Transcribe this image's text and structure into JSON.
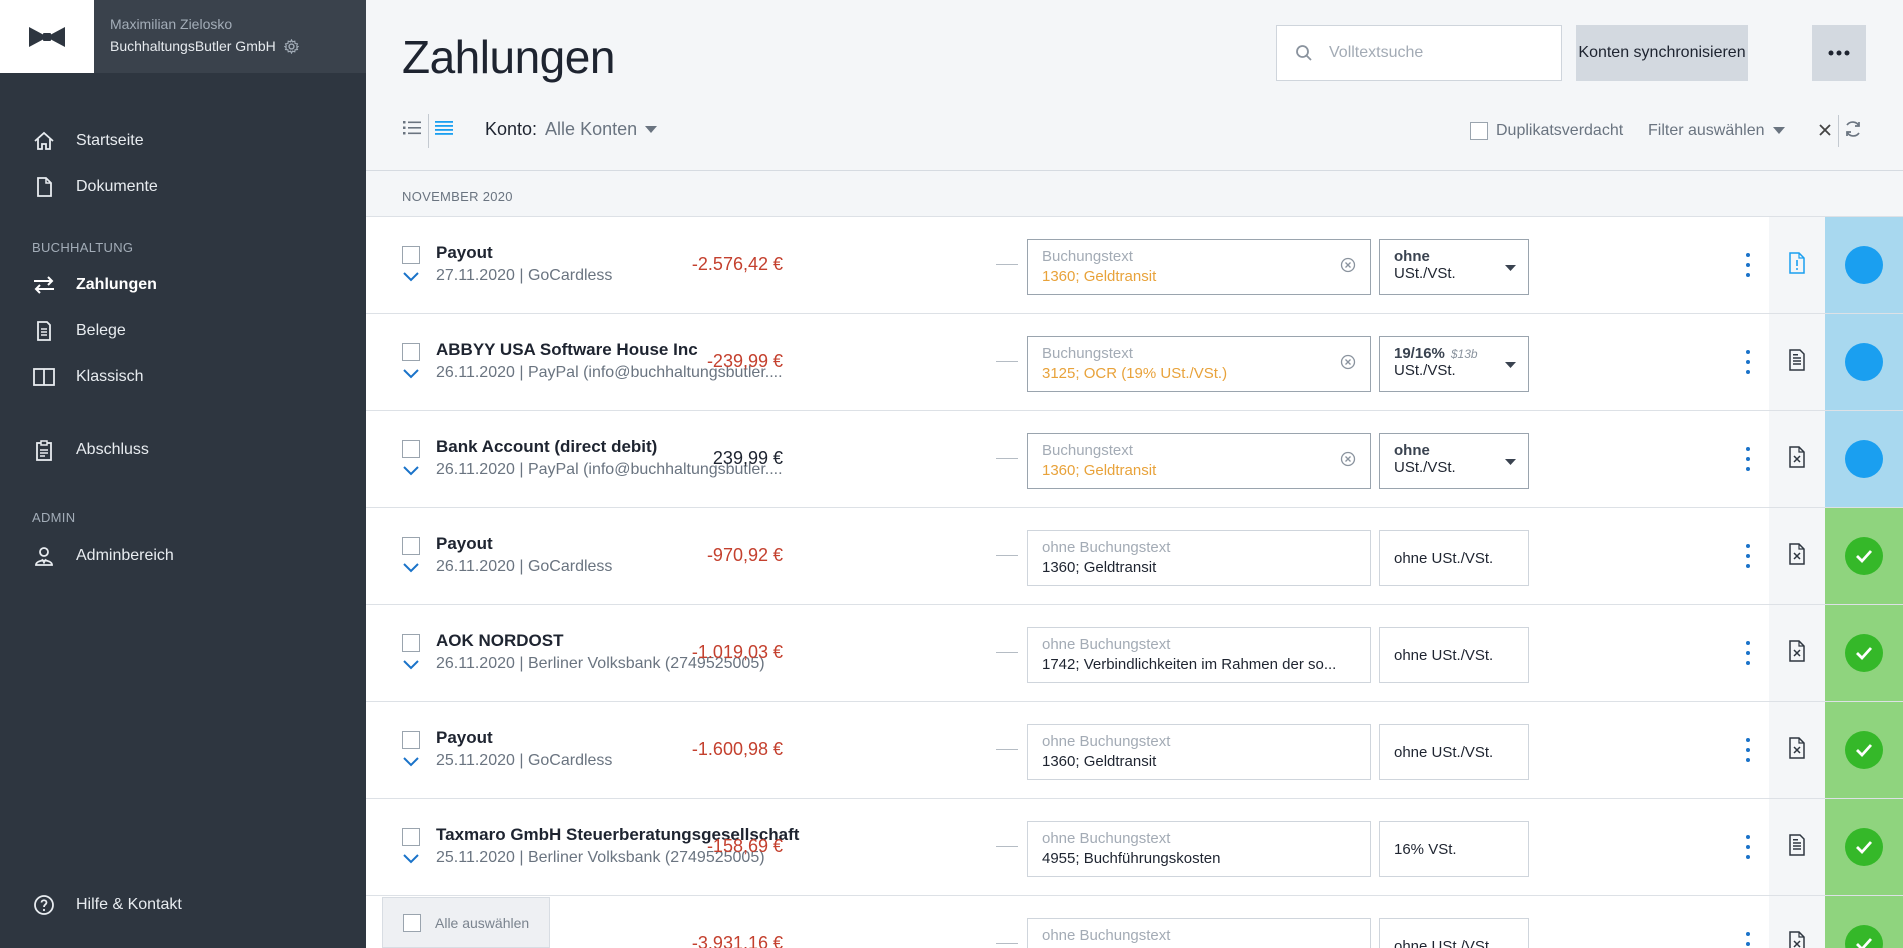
{
  "sidebar": {
    "user_name": "Maximilian Zielosko",
    "company_name": "BuchhaltungsButler GmbH",
    "items_top": [
      {
        "label": "Startseite",
        "icon": "home-icon"
      },
      {
        "label": "Dokumente",
        "icon": "document-icon"
      }
    ],
    "section_buchhaltung": "BUCHHALTUNG",
    "items_buchhaltung": [
      {
        "label": "Zahlungen",
        "icon": "transfer-arrows-icon",
        "active": true
      },
      {
        "label": "Belege",
        "icon": "receipt-icon"
      },
      {
        "label": "Klassisch",
        "icon": "book-icon"
      }
    ],
    "abschluss": "Abschluss",
    "section_admin": "ADMIN",
    "admin_item": "Adminbereich",
    "help": "Hilfe & Kontakt"
  },
  "header": {
    "title": "Zahlungen",
    "search_placeholder": "Volltextsuche",
    "sync_label": "Konten synchronisieren"
  },
  "toolbar": {
    "konto_label": "Konto:",
    "konto_value": "Alle Konten",
    "duplicate_label": "Duplikatsverdacht",
    "filter_label": "Filter auswählen"
  },
  "month_label": "NOVEMBER 2020",
  "payments": [
    {
      "name": "Payout",
      "meta": "27.11.2020 | GoCardless",
      "amount": "-2.576,42 €",
      "negative": true,
      "booking_label": "Buchungstext",
      "account": "1360; Geldtransit",
      "pending": true,
      "tax_line1": "ohne",
      "tax_line2": "USt./VSt.",
      "tax_hint": "",
      "doc": "file-alert-icon",
      "status": "open"
    },
    {
      "name": "ABBYY USA Software House Inc",
      "meta": "26.11.2020 | PayPal (info@buchhaltungsbutler....",
      "amount": "-239,99 €",
      "negative": true,
      "booking_label": "Buchungstext",
      "account": "3125; OCR (19% USt./VSt.)",
      "pending": true,
      "tax_line1": "19/16%",
      "tax_line2": "USt./VSt.",
      "tax_hint": "$13b",
      "doc": "receipt-icon",
      "status": "open"
    },
    {
      "name": "Bank Account (direct debit)",
      "meta": "26.11.2020 | PayPal (info@buchhaltungsbutler....",
      "amount": "239,99 €",
      "negative": false,
      "booking_label": "Buchungstext",
      "account": "1360; Geldtransit",
      "pending": true,
      "tax_line1": "ohne",
      "tax_line2": "USt./VSt.",
      "tax_hint": "",
      "doc": "file-x-icon",
      "status": "open"
    },
    {
      "name": "Payout",
      "meta": "26.11.2020 | GoCardless",
      "amount": "-970,92 €",
      "negative": true,
      "booking_label": "ohne Buchungstext",
      "account": "1360; Geldtransit",
      "pending": false,
      "tax_text": "ohne USt./VSt.",
      "doc": "file-x-icon",
      "status": "done"
    },
    {
      "name": "AOK NORDOST",
      "meta": "26.11.2020 | Berliner Volksbank (2749525005)",
      "amount": "-1.019,03 €",
      "negative": true,
      "booking_label": "ohne Buchungstext",
      "account": "1742; Verbindlichkeiten im Rahmen der so...",
      "pending": false,
      "tax_text": "ohne USt./VSt.",
      "doc": "file-x-icon",
      "status": "done"
    },
    {
      "name": "Payout",
      "meta": "25.11.2020 | GoCardless",
      "amount": "-1.600,98 €",
      "negative": true,
      "booking_label": "ohne Buchungstext",
      "account": "1360; Geldtransit",
      "pending": false,
      "tax_text": "ohne USt./VSt.",
      "doc": "file-x-icon",
      "status": "done"
    },
    {
      "name": "Taxmaro GmbH Steuerberatungsgesellschaft",
      "meta": "25.11.2020 | Berliner Volksbank (2749525005)",
      "amount": "-158,69 €",
      "negative": true,
      "booking_label": "ohne Buchungstext",
      "account": "4955; Buchführungskosten",
      "pending": false,
      "tax_text": "16% VSt.",
      "doc": "receipt-icon",
      "status": "done"
    },
    {
      "name": "",
      "meta": "",
      "amount": "-3.931,16 €",
      "negative": true,
      "booking_label": "ohne Buchungstext",
      "account": "",
      "pending": false,
      "tax_text": "ohne USt./VSt.",
      "doc": "file-x-icon",
      "status": "done"
    }
  ],
  "select_all_label": "Alle auswählen"
}
